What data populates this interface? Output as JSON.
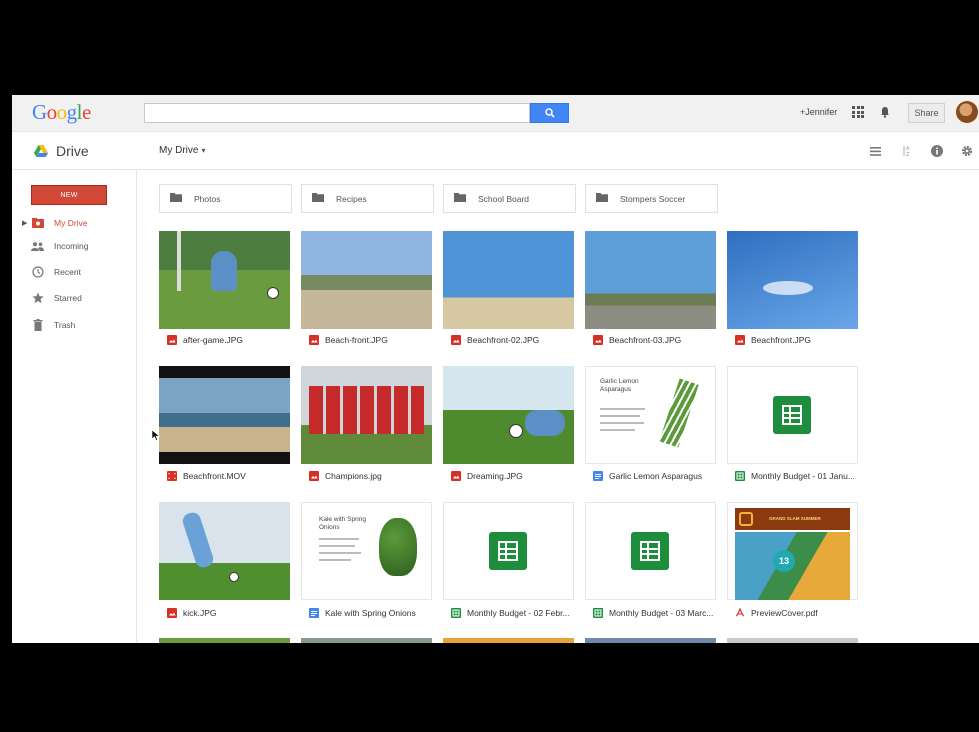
{
  "app": {
    "logo_text": "Google",
    "product": "Drive",
    "user_link": "+Jennifer",
    "share_label": "Share"
  },
  "colors": {
    "brand_red": "#d14836",
    "search_blue": "#4285f4",
    "sheet_green": "#1e8e3e",
    "doc_blue": "#4285f4",
    "pdf_red": "#d93025"
  },
  "breadcrumb": {
    "label": "My Drive",
    "caret": "▾"
  },
  "sidebar": {
    "new_label": "NEW",
    "items": [
      {
        "label": "My Drive",
        "icon": "my-drive-icon",
        "active": true
      },
      {
        "label": "Incoming",
        "icon": "incoming-icon",
        "active": false
      },
      {
        "label": "Recent",
        "icon": "recent-icon",
        "active": false
      },
      {
        "label": "Starred",
        "icon": "star-icon",
        "active": false
      },
      {
        "label": "Trash",
        "icon": "trash-icon",
        "active": false
      }
    ]
  },
  "folders": [
    {
      "name": "Photos"
    },
    {
      "name": "Recipes"
    },
    {
      "name": "School Board"
    },
    {
      "name": "Stompers Soccer"
    }
  ],
  "files": [
    {
      "name": "after-game.JPG",
      "type": "image"
    },
    {
      "name": "Beach-front.JPG",
      "type": "image"
    },
    {
      "name": "Beachfront-02.JPG",
      "type": "image"
    },
    {
      "name": "Beachfront-03.JPG",
      "type": "image"
    },
    {
      "name": "Beachfront.JPG",
      "type": "image"
    },
    {
      "name": "Beachfront.MOV",
      "type": "video"
    },
    {
      "name": "Champions.jpg",
      "type": "image"
    },
    {
      "name": "Dreaming.JPG",
      "type": "image"
    },
    {
      "name": "Garlic Lemon Asparagus",
      "type": "doc"
    },
    {
      "name": "Monthly Budget - 01 Janu...",
      "type": "sheet"
    },
    {
      "name": "kick.JPG",
      "type": "image"
    },
    {
      "name": "Kale with Spring Onions",
      "type": "doc"
    },
    {
      "name": "Monthly Budget - 02 Febr...",
      "type": "sheet"
    },
    {
      "name": "Monthly Budget - 03 Marc...",
      "type": "sheet"
    },
    {
      "name": "PreviewCover.pdf",
      "type": "pdf"
    }
  ],
  "doc_previews": {
    "garlic_title": "Garlic Lemon Asparagus",
    "kale_title": "Kale with Spring Onions",
    "preview_banner": "GRAND SLAM SUMMER",
    "preview_badge": "13"
  }
}
